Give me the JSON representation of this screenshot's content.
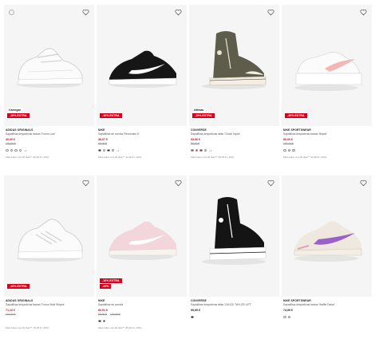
{
  "products": [
    {
      "brand": "ADIDAS ORIGINALS",
      "description": "Sapatilhas desportivas baixas 'Forum Low'",
      "price": "40,00 €",
      "price_color": "red",
      "old_price": "100,00 €",
      "old_price_2": "",
      "badges_top": [
        "Carregar"
      ],
      "badge_red": "-10% EXTRA",
      "badge_light": "",
      "swatches": [
        "#ffffff",
        "#ffffff",
        "#ffffff",
        "#ffffff"
      ],
      "more": "+5",
      "lowest": "Mais baixo nos 30 dias**: 99,00 € (-10%)",
      "shoe": "white-lowtop"
    },
    {
      "brand": "NIKE",
      "description": "Sapatilhas de corrida 'Revolution 6'",
      "price": "38,07 €",
      "price_color": "red",
      "old_price": "65,00 €",
      "old_price_2": "",
      "badges_top": [],
      "badge_red": "-10% EXTRA",
      "badge_light": "",
      "swatches": [
        "#111111",
        "#ffffff",
        "#111111",
        "#dddddd"
      ],
      "more": "+1",
      "lowest": "Mais baixo nos 30 dias**: 42,30 € (-10%)",
      "shoe": "black-runner"
    },
    {
      "brand": "CONVERSE",
      "description": "Sapatilhas desportivas altas 'Chuck Taylor'",
      "price": "53,96 €",
      "price_color": "red",
      "old_price": "85,00 €",
      "old_price_2": "",
      "badges_top": [],
      "badge_red": "-10% EXTRA",
      "badge_light": "Ultimas",
      "swatches": [
        "#6b6b5a",
        "#cc2222",
        "#aa1111",
        "#dddddd"
      ],
      "more": "+5",
      "lowest": "Mais baixo nos 30 dias**: 59,95 € (-10%)",
      "shoe": "olive-hightop"
    },
    {
      "brand": "NIKE SPORTSWEAR",
      "description": "Sapatilhas desportivas baixas 'Blazer'",
      "price": "80,00 €",
      "price_color": "red",
      "old_price": "100,00 €",
      "old_price_2": "",
      "badges_top": [],
      "badge_red": "-20% EXTRA",
      "badge_light": "",
      "swatches": [
        "#ffffff",
        "#f3c4c4",
        "#dddddd"
      ],
      "more": "",
      "lowest": "Mais baixo nos 30 dias**: 90,00 € (-20%)",
      "shoe": "pink-blazer"
    },
    {
      "brand": "ADIDAS ORIGINALS",
      "description": "Sapatilhas desportivas baixas 'Forum Bold Stripes'",
      "price": "71,10 €",
      "price_color": "red",
      "old_price": "110,00 €",
      "old_price_2": "",
      "badges_top": [],
      "badge_red": "-10% EXTRA",
      "badge_light": "",
      "swatches": [],
      "more": "",
      "lowest": "Mais baixo nos 30 dias**: 79,00 € (-10%)",
      "shoe": "white-platform"
    },
    {
      "brand": "NIKE",
      "description": "Sapatilhas de corrida",
      "price": "80,91 €",
      "price_color": "red",
      "old_price": "89,90 €",
      "old_price_2": "130,00 €",
      "badges_top": [],
      "badge_red": "-10% EXTRA",
      "badge_red_2": "-33%",
      "badge_light": "",
      "swatches": [
        "#111111",
        "#111111"
      ],
      "more": "",
      "lowest": "Mais baixo nos 30 dias**: 89,90 € (-10%)",
      "shoe": "pink-runner"
    },
    {
      "brand": "CONVERSE",
      "description": "Sapatilhas desportivas altas 'CHUCK TAYLOR LIFT'",
      "price": "99,99 €",
      "price_color": "black",
      "old_price": "",
      "old_price_2": "",
      "badges_top": [],
      "badge_red": "",
      "badge_light": "",
      "swatches": [
        "#111111"
      ],
      "more": "",
      "lowest": "",
      "shoe": "black-hightop"
    },
    {
      "brand": "NIKE SPORTSWEAR",
      "description": "Sapatilhas desportivas baixas 'Waffle Debut'",
      "price": "74,99 €",
      "price_color": "black",
      "old_price": "",
      "old_price_2": "",
      "badges_top": [],
      "badge_red": "",
      "badge_light": "",
      "swatches": [
        "#ffffff",
        "#ffffff"
      ],
      "more": "",
      "lowest": "",
      "shoe": "purple-waffle"
    }
  ]
}
